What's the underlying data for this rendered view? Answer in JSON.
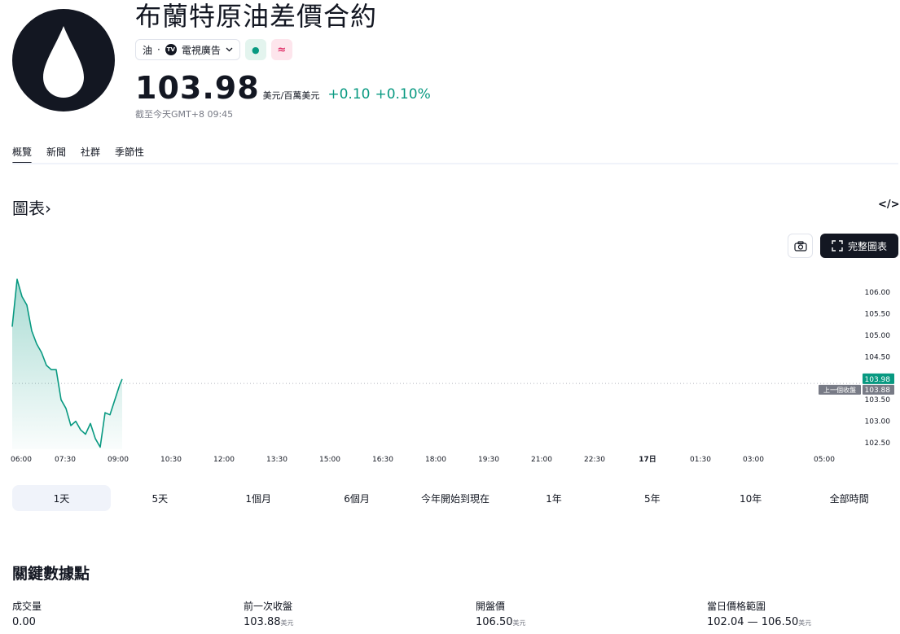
{
  "header": {
    "title": "布蘭特原油差價合約",
    "chip_category": "油",
    "chip_sep": "·",
    "tv_logo": "TV",
    "chip_ad": "電視廣告",
    "dot_glyph": "●",
    "approx_glyph": "≈",
    "price": "103.98",
    "unit": "美元/百萬美元",
    "change": "+0.10",
    "change_pct": "+0.10%",
    "as_of": "截至今天GMT+8 09:45"
  },
  "tabs": [
    {
      "label": "概覽",
      "active": true
    },
    {
      "label": "新聞",
      "active": false
    },
    {
      "label": "社群",
      "active": false
    },
    {
      "label": "季節性",
      "active": false
    }
  ],
  "chart_section": {
    "title": "圖表",
    "chevron": "›",
    "embed_glyph": "</>",
    "fullscreen_label": "完整圖表"
  },
  "chart_data": {
    "type": "area",
    "x_ticks": [
      "06:00",
      "07:30",
      "09:00",
      "10:30",
      "12:00",
      "13:30",
      "15:00",
      "16:30",
      "18:00",
      "19:30",
      "21:00",
      "22:30",
      "17日",
      "01:30",
      "03:00",
      "05:00"
    ],
    "y_ticks": [
      "106.00",
      "105.50",
      "105.00",
      "104.50",
      "104.00",
      "103.50",
      "103.00",
      "102.50"
    ],
    "ylim": [
      102.35,
      106.55
    ],
    "last_price_label": "103.98",
    "prev_close_label": "103.88",
    "prev_close_text": "上一個收盤",
    "prev_close": 103.88,
    "line_color": "#089981",
    "series": [
      {
        "x": [
          "06:00",
          "06:10",
          "06:20",
          "06:30",
          "06:40",
          "06:50",
          "07:00",
          "07:10",
          "07:20",
          "07:30",
          "07:40",
          "07:50",
          "08:00",
          "08:10",
          "08:20",
          "08:30",
          "08:40",
          "08:50",
          "09:00",
          "09:10",
          "09:20",
          "09:30",
          "09:40",
          "09:45"
        ],
        "values": [
          105.2,
          106.3,
          105.9,
          105.7,
          105.1,
          104.8,
          104.6,
          104.3,
          104.2,
          104.2,
          103.5,
          103.3,
          102.9,
          103.0,
          102.8,
          102.7,
          102.95,
          102.6,
          102.4,
          103.2,
          103.15,
          103.5,
          103.85,
          103.98
        ]
      }
    ]
  },
  "ranges": [
    {
      "label": "1天",
      "active": true
    },
    {
      "label": "5天",
      "active": false
    },
    {
      "label": "1個月",
      "active": false
    },
    {
      "label": "6個月",
      "active": false
    },
    {
      "label": "今年開始到現在",
      "active": false
    },
    {
      "label": "1年",
      "active": false
    },
    {
      "label": "5年",
      "active": false
    },
    {
      "label": "10年",
      "active": false
    },
    {
      "label": "全部時間",
      "active": false
    }
  ],
  "key_stats": {
    "title": "關鍵數據點",
    "items": [
      {
        "label": "成交量",
        "value": "0.00",
        "unit": ""
      },
      {
        "label": "前一次收盤",
        "value": "103.88",
        "unit": "美元"
      },
      {
        "label": "開盤價",
        "value": "106.50",
        "unit": "美元"
      },
      {
        "label": "當日價格範圍",
        "value": "102.04 — 106.50",
        "unit": "美元"
      }
    ]
  }
}
